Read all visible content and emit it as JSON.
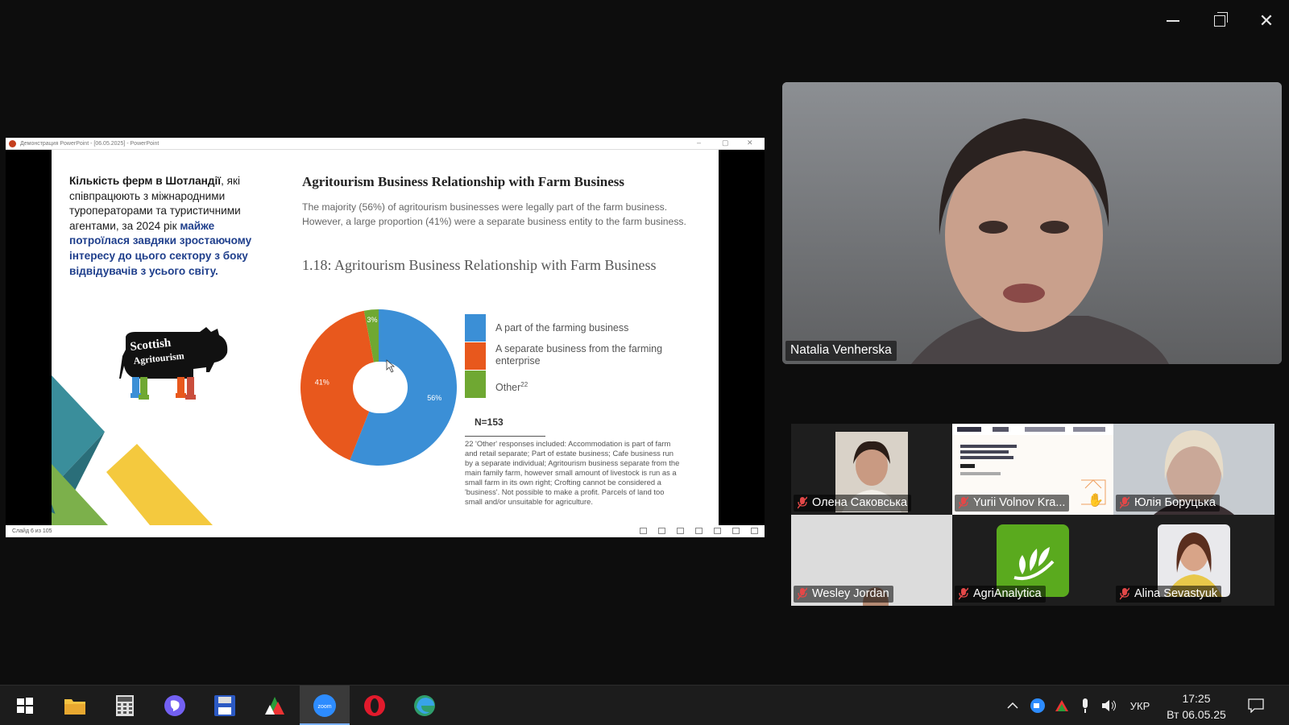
{
  "window_controls": {
    "minimize": "minimize",
    "maximize": "restore",
    "close": "close"
  },
  "powerpoint": {
    "title_bar": "Демонстрация PowerPoint - [06.05.2025] - PowerPoint",
    "status": "Слайд 6 из 105"
  },
  "slide": {
    "uk_text": {
      "part1": "Кількість ферм в Шотландії",
      "part2": ", які співпрацюють з міжнародними туроператорами та туристичними агентами, за 2024 рік ",
      "part3": "майже потроїлася завдяки зростаючому інтересу до цього сектору з боку відвідувачів з усього світу."
    },
    "logo": {
      "line1": "Scottish",
      "line2": "Agritourism"
    },
    "title": "Agritourism Business Relationship with Farm Business",
    "body": "The majority (56%) of agritourism businesses were legally part of the farm business. However, a large proportion (41%) were a separate business entity to the farm business.",
    "figure_title": "1.18: Agritourism Business Relationship with Farm Business",
    "n_label": "N=153",
    "footnote": "22   'Other' responses included: Accommodation is part of farm and retail separate; Part of estate business; Cafe business run by a separate individual; Agritourism business separate from the main family farm, however small amount of livestock is run as a small farm in its own right; Crofting cannot be considered a 'business'. Not possible to make a profit. Parcels of land too small and/or unsuitable for agriculture."
  },
  "chart_data": {
    "type": "pie",
    "title": "1.18: Agritourism Business Relationship with Farm Business",
    "categories": [
      "A part of the farming business",
      "A separate business from the farming enterprise",
      "Other"
    ],
    "values": [
      56,
      41,
      3
    ],
    "value_labels": [
      "56%",
      "41%",
      "3%"
    ],
    "colors": [
      "#3b8fd6",
      "#e8581d",
      "#6fa832"
    ],
    "legend": [
      {
        "label": "A part of the farming business",
        "sup": ""
      },
      {
        "label": "A separate business from the farming enterprise",
        "sup": ""
      },
      {
        "label": "Other",
        "sup": "22"
      }
    ],
    "legend_position": "right",
    "note": "N=153"
  },
  "speaker": {
    "name": "Natalia Venherska"
  },
  "participants": [
    {
      "name": "Олена Саковська",
      "muted": true
    },
    {
      "name": "Yurii Volnov Kra...",
      "muted": true
    },
    {
      "name": "Юлія Боруцька",
      "muted": true
    },
    {
      "name": "Wesley Jordan",
      "muted": true
    },
    {
      "name": "AgriAnalytica",
      "muted": true
    },
    {
      "name": "Alina Sevastyuk",
      "muted": true
    }
  ],
  "taskbar": {
    "apps": [
      "start",
      "file-explorer",
      "calculator",
      "viber",
      "save-app",
      "media-app",
      "zoom",
      "opera",
      "edge"
    ],
    "zoom_label": "zoom",
    "language": "УКР",
    "time": "17:25",
    "date": "Вт 06.05.25"
  }
}
